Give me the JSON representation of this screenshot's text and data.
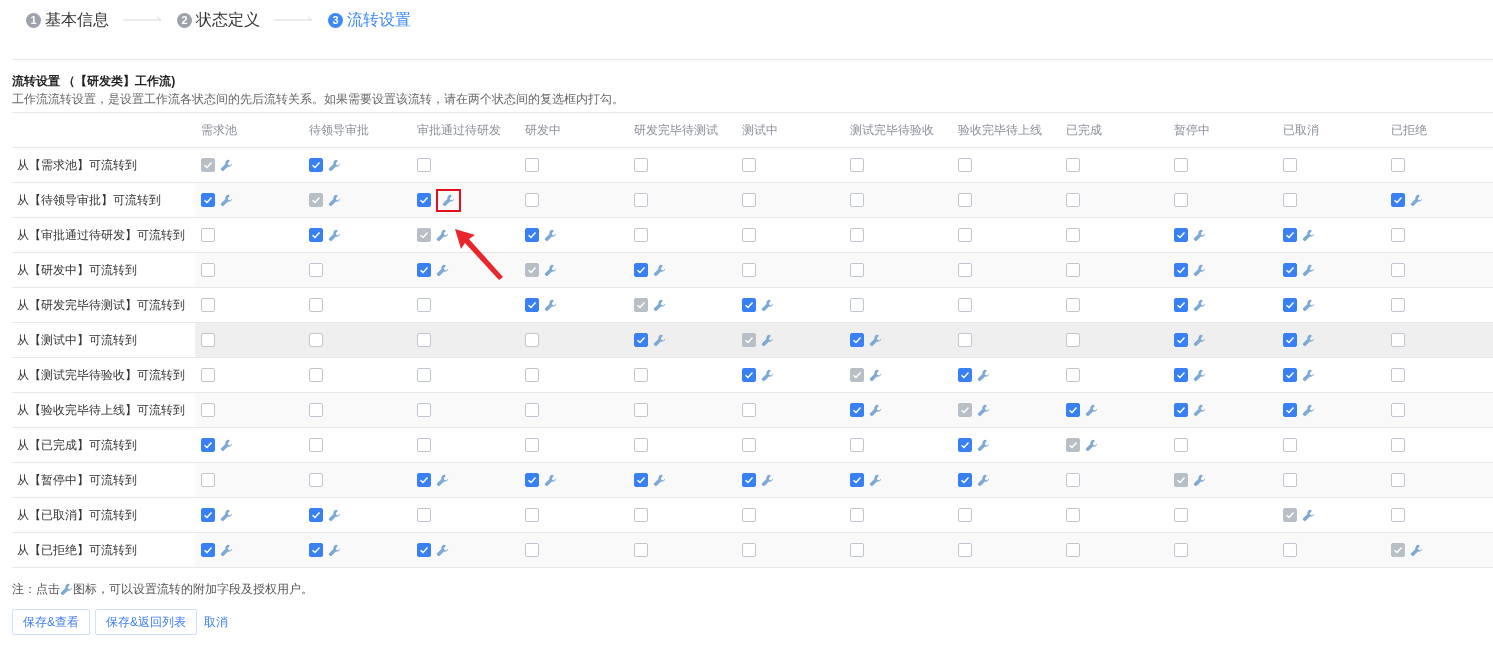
{
  "steps": [
    {
      "number": "1",
      "label": "基本信息",
      "active": false
    },
    {
      "number": "2",
      "label": "状态定义",
      "active": false
    },
    {
      "number": "3",
      "label": "流转设置",
      "active": true
    }
  ],
  "section": {
    "title": "流转设置 （【研发类】工作流)",
    "description": "工作流流转设置，是设置工作流各状态间的先后流转关系。如果需要设置该流转，请在两个状态间的复选框内打勾。"
  },
  "columns": [
    "需求池",
    "待领导审批",
    "审批通过待研发",
    "研发中",
    "研发完毕待测试",
    "测试中",
    "测试完毕待验收",
    "验收完毕待上线",
    "已完成",
    "暂停中",
    "已取消",
    "已拒绝"
  ],
  "rows": [
    {
      "label": "从【需求池】可流转到",
      "hovered": false,
      "cells": [
        {
          "checked": true,
          "disabled": true
        },
        {
          "checked": true,
          "disabled": false
        },
        {
          "checked": false,
          "disabled": false
        },
        {
          "checked": false,
          "disabled": false
        },
        {
          "checked": false,
          "disabled": false
        },
        {
          "checked": false,
          "disabled": false
        },
        {
          "checked": false,
          "disabled": false
        },
        {
          "checked": false,
          "disabled": false
        },
        {
          "checked": false,
          "disabled": false
        },
        {
          "checked": false,
          "disabled": false
        },
        {
          "checked": false,
          "disabled": false
        },
        {
          "checked": false,
          "disabled": false
        }
      ]
    },
    {
      "label": "从【待领导审批】可流转到",
      "hovered": false,
      "cells": [
        {
          "checked": true,
          "disabled": false
        },
        {
          "checked": true,
          "disabled": true
        },
        {
          "checked": true,
          "disabled": false,
          "highlighted": true
        },
        {
          "checked": false,
          "disabled": false
        },
        {
          "checked": false,
          "disabled": false
        },
        {
          "checked": false,
          "disabled": false
        },
        {
          "checked": false,
          "disabled": false
        },
        {
          "checked": false,
          "disabled": false
        },
        {
          "checked": false,
          "disabled": false
        },
        {
          "checked": false,
          "disabled": false
        },
        {
          "checked": false,
          "disabled": false
        },
        {
          "checked": true,
          "disabled": false
        }
      ]
    },
    {
      "label": "从【审批通过待研发】可流转到",
      "hovered": false,
      "cells": [
        {
          "checked": false,
          "disabled": false
        },
        {
          "checked": true,
          "disabled": false
        },
        {
          "checked": true,
          "disabled": true
        },
        {
          "checked": true,
          "disabled": false
        },
        {
          "checked": false,
          "disabled": false
        },
        {
          "checked": false,
          "disabled": false
        },
        {
          "checked": false,
          "disabled": false
        },
        {
          "checked": false,
          "disabled": false
        },
        {
          "checked": false,
          "disabled": false
        },
        {
          "checked": true,
          "disabled": false
        },
        {
          "checked": true,
          "disabled": false
        },
        {
          "checked": false,
          "disabled": false
        }
      ]
    },
    {
      "label": "从【研发中】可流转到",
      "hovered": false,
      "cells": [
        {
          "checked": false,
          "disabled": false
        },
        {
          "checked": false,
          "disabled": false
        },
        {
          "checked": true,
          "disabled": false
        },
        {
          "checked": true,
          "disabled": true
        },
        {
          "checked": true,
          "disabled": false
        },
        {
          "checked": false,
          "disabled": false
        },
        {
          "checked": false,
          "disabled": false
        },
        {
          "checked": false,
          "disabled": false
        },
        {
          "checked": false,
          "disabled": false
        },
        {
          "checked": true,
          "disabled": false
        },
        {
          "checked": true,
          "disabled": false
        },
        {
          "checked": false,
          "disabled": false
        }
      ]
    },
    {
      "label": "从【研发完毕待测试】可流转到",
      "hovered": false,
      "cells": [
        {
          "checked": false,
          "disabled": false
        },
        {
          "checked": false,
          "disabled": false
        },
        {
          "checked": false,
          "disabled": false
        },
        {
          "checked": true,
          "disabled": false
        },
        {
          "checked": true,
          "disabled": true
        },
        {
          "checked": true,
          "disabled": false
        },
        {
          "checked": false,
          "disabled": false
        },
        {
          "checked": false,
          "disabled": false
        },
        {
          "checked": false,
          "disabled": false
        },
        {
          "checked": true,
          "disabled": false
        },
        {
          "checked": true,
          "disabled": false
        },
        {
          "checked": false,
          "disabled": false
        }
      ]
    },
    {
      "label": "从【测试中】可流转到",
      "hovered": true,
      "cells": [
        {
          "checked": false,
          "disabled": false
        },
        {
          "checked": false,
          "disabled": false
        },
        {
          "checked": false,
          "disabled": false
        },
        {
          "checked": false,
          "disabled": false
        },
        {
          "checked": true,
          "disabled": false
        },
        {
          "checked": true,
          "disabled": true
        },
        {
          "checked": true,
          "disabled": false
        },
        {
          "checked": false,
          "disabled": false
        },
        {
          "checked": false,
          "disabled": false
        },
        {
          "checked": true,
          "disabled": false
        },
        {
          "checked": true,
          "disabled": false
        },
        {
          "checked": false,
          "disabled": false
        }
      ]
    },
    {
      "label": "从【测试完毕待验收】可流转到",
      "hovered": false,
      "cells": [
        {
          "checked": false,
          "disabled": false
        },
        {
          "checked": false,
          "disabled": false
        },
        {
          "checked": false,
          "disabled": false
        },
        {
          "checked": false,
          "disabled": false
        },
        {
          "checked": false,
          "disabled": false
        },
        {
          "checked": true,
          "disabled": false
        },
        {
          "checked": true,
          "disabled": true
        },
        {
          "checked": true,
          "disabled": false
        },
        {
          "checked": false,
          "disabled": false
        },
        {
          "checked": true,
          "disabled": false
        },
        {
          "checked": true,
          "disabled": false
        },
        {
          "checked": false,
          "disabled": false
        }
      ]
    },
    {
      "label": "从【验收完毕待上线】可流转到",
      "hovered": false,
      "cells": [
        {
          "checked": false,
          "disabled": false
        },
        {
          "checked": false,
          "disabled": false
        },
        {
          "checked": false,
          "disabled": false
        },
        {
          "checked": false,
          "disabled": false
        },
        {
          "checked": false,
          "disabled": false
        },
        {
          "checked": false,
          "disabled": false
        },
        {
          "checked": true,
          "disabled": false
        },
        {
          "checked": true,
          "disabled": true
        },
        {
          "checked": true,
          "disabled": false
        },
        {
          "checked": true,
          "disabled": false
        },
        {
          "checked": true,
          "disabled": false
        },
        {
          "checked": false,
          "disabled": false
        }
      ]
    },
    {
      "label": "从【已完成】可流转到",
      "hovered": false,
      "cells": [
        {
          "checked": true,
          "disabled": false
        },
        {
          "checked": false,
          "disabled": false
        },
        {
          "checked": false,
          "disabled": false
        },
        {
          "checked": false,
          "disabled": false
        },
        {
          "checked": false,
          "disabled": false
        },
        {
          "checked": false,
          "disabled": false
        },
        {
          "checked": false,
          "disabled": false
        },
        {
          "checked": true,
          "disabled": false
        },
        {
          "checked": true,
          "disabled": true
        },
        {
          "checked": false,
          "disabled": false
        },
        {
          "checked": false,
          "disabled": false
        },
        {
          "checked": false,
          "disabled": false
        }
      ]
    },
    {
      "label": "从【暂停中】可流转到",
      "hovered": false,
      "cells": [
        {
          "checked": false,
          "disabled": false
        },
        {
          "checked": false,
          "disabled": false
        },
        {
          "checked": true,
          "disabled": false
        },
        {
          "checked": true,
          "disabled": false
        },
        {
          "checked": true,
          "disabled": false
        },
        {
          "checked": true,
          "disabled": false
        },
        {
          "checked": true,
          "disabled": false
        },
        {
          "checked": true,
          "disabled": false
        },
        {
          "checked": false,
          "disabled": false
        },
        {
          "checked": true,
          "disabled": true
        },
        {
          "checked": false,
          "disabled": false
        },
        {
          "checked": false,
          "disabled": false
        }
      ]
    },
    {
      "label": "从【已取消】可流转到",
      "hovered": false,
      "cells": [
        {
          "checked": true,
          "disabled": false
        },
        {
          "checked": true,
          "disabled": false
        },
        {
          "checked": false,
          "disabled": false
        },
        {
          "checked": false,
          "disabled": false
        },
        {
          "checked": false,
          "disabled": false
        },
        {
          "checked": false,
          "disabled": false
        },
        {
          "checked": false,
          "disabled": false
        },
        {
          "checked": false,
          "disabled": false
        },
        {
          "checked": false,
          "disabled": false
        },
        {
          "checked": false,
          "disabled": false
        },
        {
          "checked": true,
          "disabled": true
        },
        {
          "checked": false,
          "disabled": false
        }
      ]
    },
    {
      "label": "从【已拒绝】可流转到",
      "hovered": false,
      "cells": [
        {
          "checked": true,
          "disabled": false
        },
        {
          "checked": true,
          "disabled": false
        },
        {
          "checked": true,
          "disabled": false
        },
        {
          "checked": false,
          "disabled": false
        },
        {
          "checked": false,
          "disabled": false
        },
        {
          "checked": false,
          "disabled": false
        },
        {
          "checked": false,
          "disabled": false
        },
        {
          "checked": false,
          "disabled": false
        },
        {
          "checked": false,
          "disabled": false
        },
        {
          "checked": false,
          "disabled": false
        },
        {
          "checked": false,
          "disabled": false
        },
        {
          "checked": true,
          "disabled": true
        }
      ]
    }
  ],
  "note": {
    "before": "注：点击",
    "after": "图标，可以设置流转的附加字段及授权用户。"
  },
  "actions": [
    {
      "label": "保存&查看",
      "kind": "button"
    },
    {
      "label": "保存&返回列表",
      "kind": "button"
    },
    {
      "label": "取消",
      "kind": "link"
    }
  ]
}
